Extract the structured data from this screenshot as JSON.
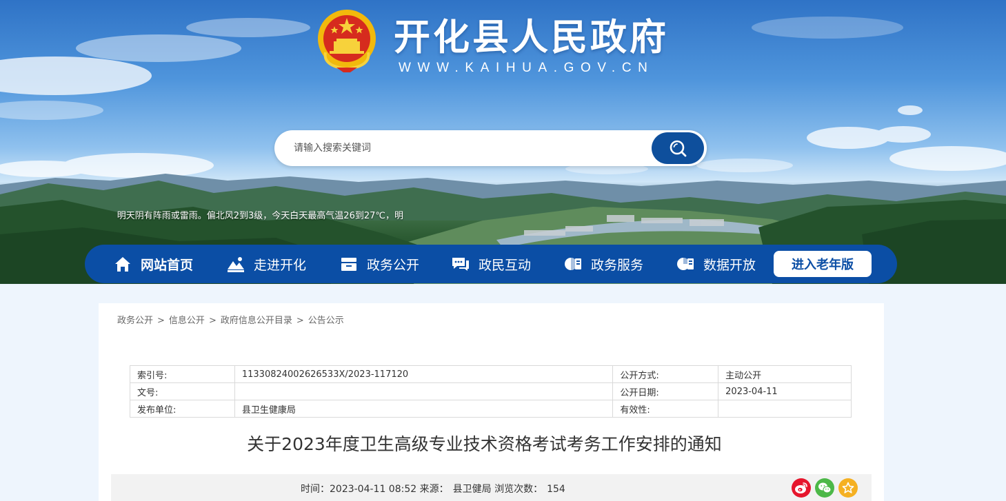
{
  "site": {
    "title": "开化县人民政府",
    "url": "WWW.KAIHUA.GOV.CN"
  },
  "search": {
    "placeholder": "请输入搜索关键词"
  },
  "weather": {
    "text": "明天阴有阵雨或雷雨。偏北风2到3级，今天白天最高气温26到27℃，明"
  },
  "nav": {
    "items": [
      {
        "label": "网站首页",
        "icon": "home-icon"
      },
      {
        "label": "走进开化",
        "icon": "landscape-icon"
      },
      {
        "label": "政务公开",
        "icon": "files-icon"
      },
      {
        "label": "政民互动",
        "icon": "chat-icon"
      },
      {
        "label": "政务服务",
        "icon": "service-icon"
      },
      {
        "label": "数据开放",
        "icon": "data-icon"
      }
    ],
    "elder_label": "进入老年版"
  },
  "breadcrumb": [
    "政务公开",
    "信息公开",
    "政府信息公开目录",
    "公告公示"
  ],
  "meta": {
    "index_label": "索引号:",
    "index_value": "11330824002626533X/2023-117120",
    "open_mode_label": "公开方式:",
    "open_mode_value": "主动公开",
    "doc_no_label": "文号:",
    "doc_no_value": "",
    "open_date_label": "公开日期:",
    "open_date_value": "2023-04-11",
    "publisher_label": "发布单位:",
    "publisher_value": "县卫生健康局",
    "validity_label": "有效性:",
    "validity_value": ""
  },
  "document": {
    "title": "关于2023年度卫生高级专业技术资格考试考务工作安排的通知"
  },
  "info": {
    "time_label": "时间：",
    "time_value": "2023-04-11 08:52",
    "source_label": "来源：",
    "source_value": "县卫健局",
    "views_label": "浏览次数：",
    "views_value": "154"
  },
  "share": [
    "weibo-icon",
    "wechat-icon",
    "favorite-icon"
  ],
  "colors": {
    "nav_bg": "#0b4ea5",
    "search_btn": "#0e4f9c",
    "page_bg": "#eef5fd"
  }
}
